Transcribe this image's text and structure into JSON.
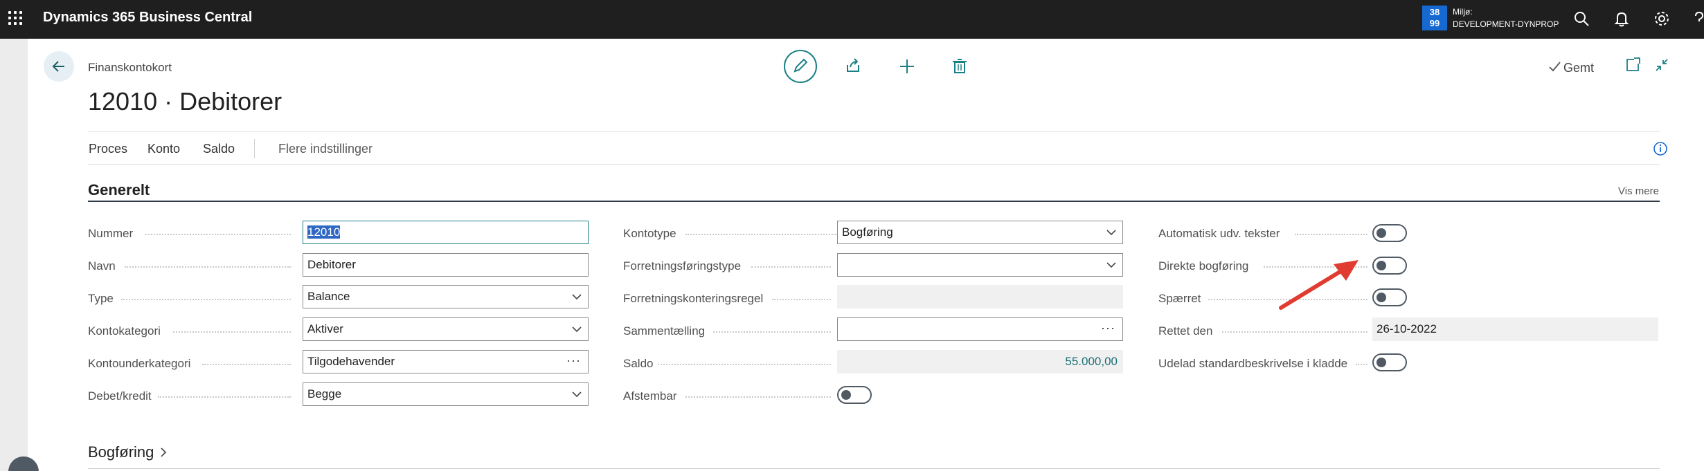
{
  "app": {
    "title": "Dynamics 365 Business Central"
  },
  "environment": {
    "badge_top": "38",
    "badge_bottom": "99",
    "label": "Miljø:",
    "value": "DEVELOPMENT-DYNPROP"
  },
  "header": {
    "breadcrumb": "Finanskontokort",
    "title": "12010 · Debitorer",
    "saved_label": "Gemt"
  },
  "actions": {
    "items": [
      "Proces",
      "Konto",
      "Saldo"
    ],
    "more_options": "Flere indstillinger"
  },
  "general": {
    "title": "Generelt",
    "show_more": "Vis mere",
    "col1": [
      {
        "label": "Nummer",
        "value": "12010"
      },
      {
        "label": "Navn",
        "value": "Debitorer"
      },
      {
        "label": "Type",
        "value": "Balance"
      },
      {
        "label": "Kontokategori",
        "value": "Aktiver"
      },
      {
        "label": "Kontounderkategori",
        "value": "Tilgodehavender"
      },
      {
        "label": "Debet/kredit",
        "value": "Begge"
      }
    ],
    "col2": [
      {
        "label": "Kontotype",
        "value": "Bogføring"
      },
      {
        "label": "Forretningsføringstype",
        "value": ""
      },
      {
        "label": "Forretningskonteringsregel",
        "value": ""
      },
      {
        "label": "Sammentælling",
        "value": ""
      },
      {
        "label": "Saldo",
        "value": "55.000,00"
      },
      {
        "label": "Afstembar",
        "state": "off"
      }
    ],
    "col3": [
      {
        "label": "Automatisk udv. tekster",
        "state": "off"
      },
      {
        "label": "Direkte bogføring",
        "state": "off"
      },
      {
        "label": "Spærret",
        "state": "off"
      },
      {
        "label": "Rettet den",
        "value": "26-10-2022"
      },
      {
        "label": "Udelad standardbeskrivelse i kladde",
        "state": "off"
      }
    ]
  },
  "posting": {
    "title": "Bogføring"
  },
  "colors": {
    "topbar": "#1f1f1f",
    "accent": "#1b7f86",
    "badge": "#1569d1",
    "annotation_arrow": "#e03c31"
  }
}
